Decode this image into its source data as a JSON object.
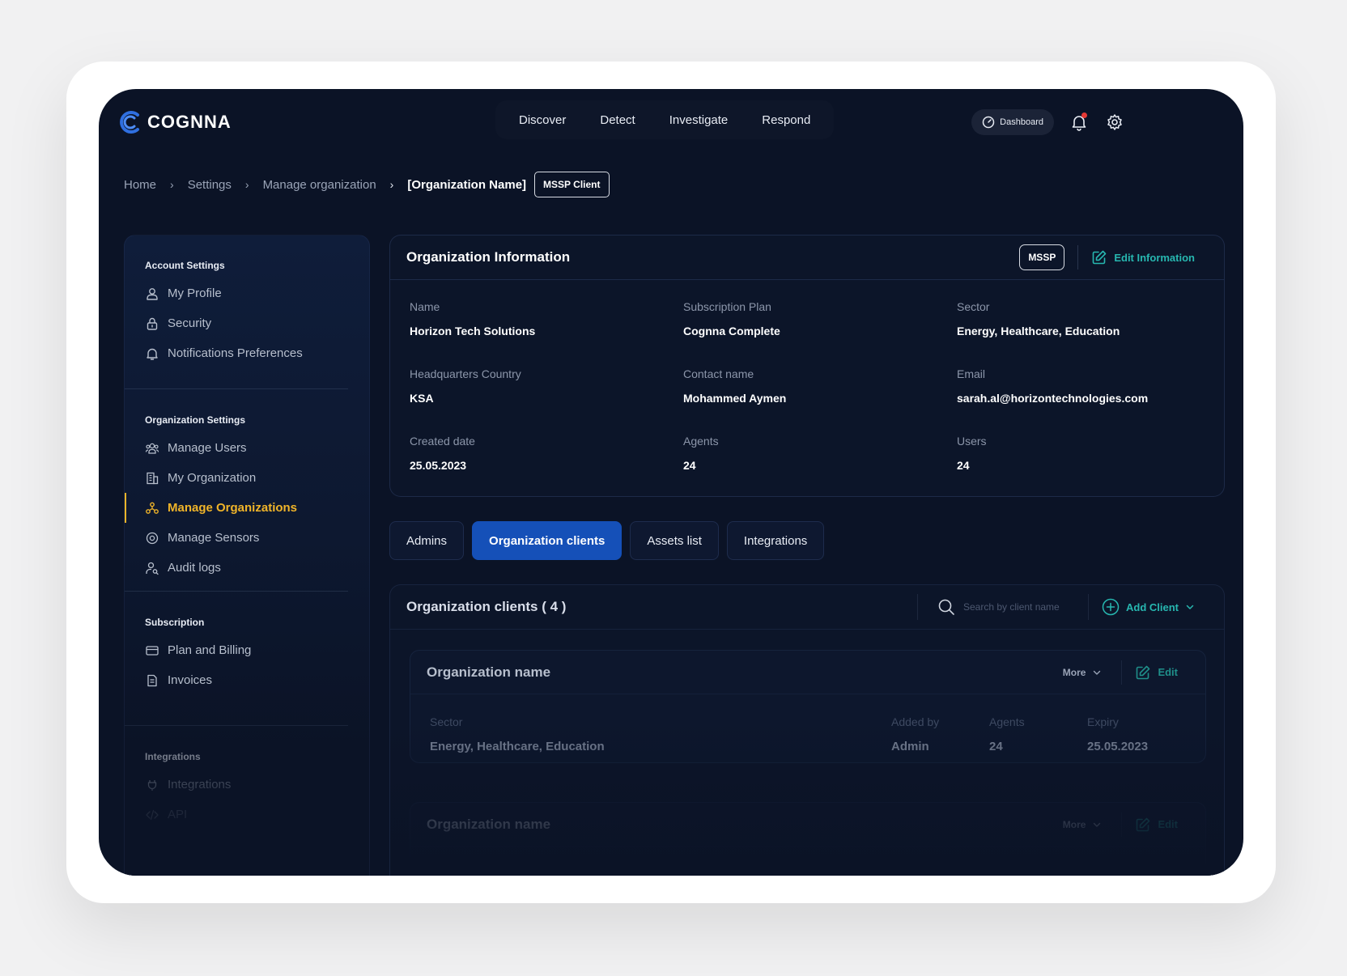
{
  "brand": {
    "name": "COGNNA"
  },
  "topnav": [
    "Discover",
    "Detect",
    "Investigate",
    "Respond"
  ],
  "header": {
    "dashboard_label": "Dashboard"
  },
  "breadcrumb": {
    "items": [
      "Home",
      "Settings",
      "Manage organization"
    ],
    "current": "[Organization Name]",
    "badge": "MSSP Client"
  },
  "sidebar": {
    "account_title": "Account Settings",
    "account_items": [
      "My Profile",
      "Security",
      "Notifications Preferences"
    ],
    "org_title": "Organization Settings",
    "org_items": [
      "Manage Users",
      "My Organization",
      "Manage Organizations",
      "Manage Sensors",
      "Audit logs"
    ],
    "subscription_title": "Subscription",
    "subscription_items": [
      "Plan and Billing",
      "Invoices"
    ],
    "integrations_title": "Integrations",
    "integrations_items": [
      "Integrations",
      "API"
    ]
  },
  "org_info": {
    "title": "Organization Information",
    "tag": "MSSP",
    "edit_label": "Edit Information",
    "fields": [
      {
        "label": "Name",
        "value": "Horizon Tech Solutions"
      },
      {
        "label": "Subscription Plan",
        "value": "Cognna Complete"
      },
      {
        "label": "Sector",
        "value": "Energy, Healthcare, Education"
      },
      {
        "label": "Headquarters Country",
        "value": "KSA"
      },
      {
        "label": "Contact name",
        "value": "Mohammed Aymen"
      },
      {
        "label": "Email",
        "value": "sarah.al@horizontechnologies.com"
      },
      {
        "label": "Created date",
        "value": "25.05.2023"
      },
      {
        "label": "Agents",
        "value": "24"
      },
      {
        "label": "Users",
        "value": "24"
      }
    ]
  },
  "tabs": [
    "Admins",
    "Organization clients",
    "Assets list",
    "Integrations"
  ],
  "clients": {
    "title": "Organization clients ( 4 )",
    "search_placeholder": "Search by client name",
    "add_label": "Add Client",
    "cards": [
      {
        "title": "Organization name",
        "more_label": "More",
        "edit_label": "Edit",
        "sector_label": "Sector",
        "sector": "Energy, Healthcare, Education",
        "added_by_label": "Added by",
        "added_by": "Admin",
        "agents_label": "Agents",
        "agents": "24",
        "expiry_label": "Expiry",
        "expiry": "25.05.2023"
      },
      {
        "title": "Organization name",
        "more_label": "More",
        "edit_label": "Edit"
      }
    ]
  },
  "colors": {
    "background": "#0b1326",
    "accent": "#1550b8",
    "active_nav": "#f0b429",
    "link": "#27b7b0",
    "notification": "#e53935"
  }
}
